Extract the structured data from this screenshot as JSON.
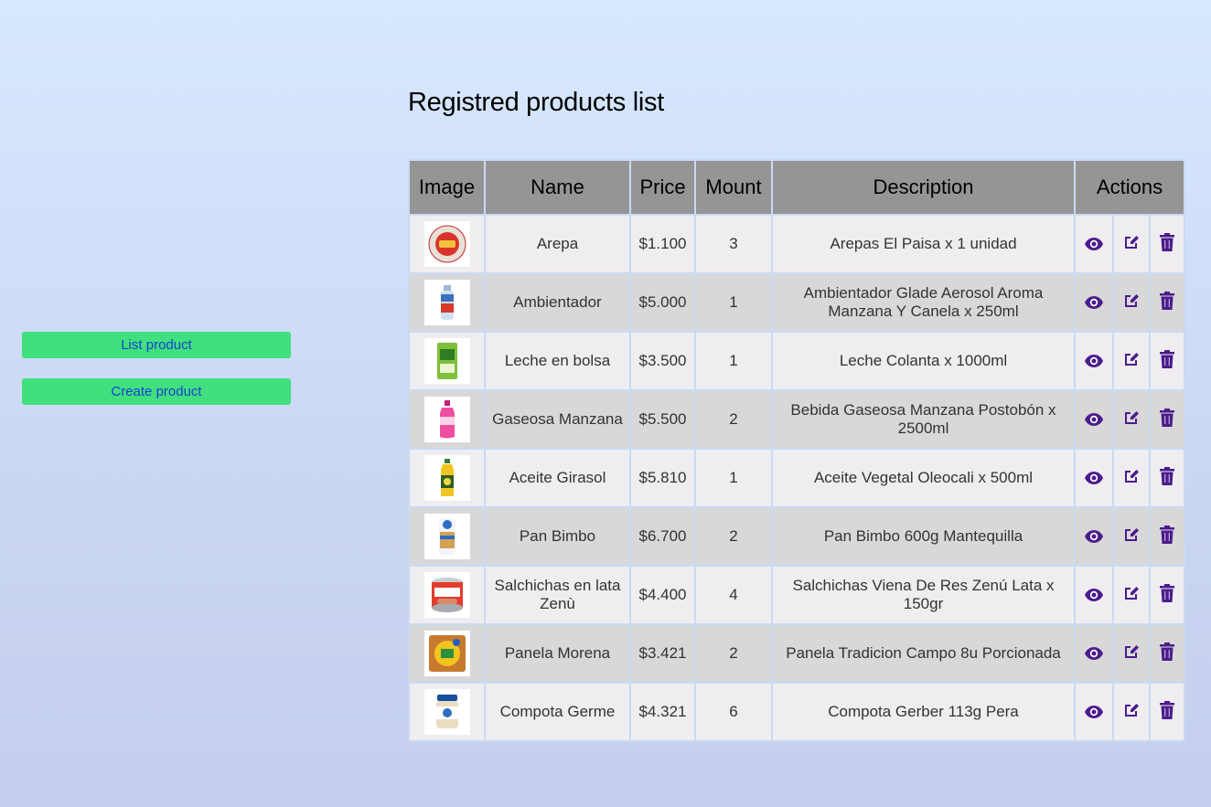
{
  "sidebar": {
    "list_label": "List product",
    "create_label": "Create product"
  },
  "page": {
    "title": "Registred products list"
  },
  "table": {
    "headers": {
      "image": "Image",
      "name": "Name",
      "price": "Price",
      "mount": "Mount",
      "description": "Description",
      "actions": "Actions"
    },
    "rows": [
      {
        "name": "Arepa",
        "price": "$1.100",
        "mount": "3",
        "description": "Arepas El Paisa x 1 unidad",
        "image": "arepa-package"
      },
      {
        "name": "Ambientador",
        "price": "$5.000",
        "mount": "1",
        "description": "Ambientador Glade Aerosol Aroma Manzana Y Canela x 250ml",
        "image": "aerosol-can"
      },
      {
        "name": "Leche en bolsa",
        "price": "$3.500",
        "mount": "1",
        "description": "Leche Colanta x 1000ml",
        "image": "milk-bag"
      },
      {
        "name": "Gaseosa Manzana",
        "price": "$5.500",
        "mount": "2",
        "description": "Bebida Gaseosa Manzana Postobón x 2500ml",
        "image": "soda-bottle"
      },
      {
        "name": "Aceite Girasol",
        "price": "$5.810",
        "mount": "1",
        "description": "Aceite Vegetal Oleocali x 500ml",
        "image": "oil-bottle"
      },
      {
        "name": "Pan Bimbo",
        "price": "$6.700",
        "mount": "2",
        "description": "Pan Bimbo 600g Mantequilla",
        "image": "bread-bag"
      },
      {
        "name": "Salchichas en lata Zenù",
        "price": "$4.400",
        "mount": "4",
        "description": "Salchichas Viena De Res Zenú Lata x 150gr",
        "image": "sausage-can"
      },
      {
        "name": "Panela Morena",
        "price": "$3.421",
        "mount": "2",
        "description": "Panela Tradicion Campo 8u Porcionada",
        "image": "panela-pack"
      },
      {
        "name": "Compota Germe",
        "price": "$4.321",
        "mount": "6",
        "description": "Compota Gerber 113g Pera",
        "image": "baby-food-jar"
      }
    ]
  },
  "icons": {
    "view": "eye-icon",
    "edit": "edit-icon",
    "delete": "trash-icon"
  },
  "colors": {
    "accent_button": "#3fe07d",
    "button_text": "#1a3fd6",
    "header_bg": "#959595",
    "action_icon": "#4b1c8c"
  }
}
